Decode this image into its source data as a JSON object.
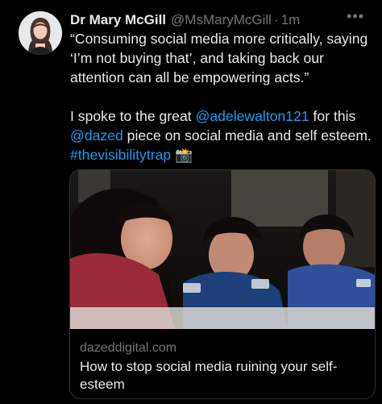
{
  "tweet": {
    "author_name": "Dr Mary McGill",
    "handle": "@MsMaryMcGill",
    "separator": "·",
    "time": "1m",
    "more_icon": "ellipsis-icon",
    "quote_text": "“Consuming social media more critically, saying ‘I’m not buying that’, and taking back our attention can all be empowering acts.”",
    "line2_prefix": "I spoke to the great ",
    "mention1": "@adelewalton121",
    "line2_mid": " for this ",
    "mention2": "@dazed",
    "line2_suffix": " piece on social media and self esteem. ",
    "hashtag": "#thevisibilitytrap",
    "emoji": "📸"
  },
  "card": {
    "domain": "dazeddigital.com",
    "title": "How to stop social media ruining your self-esteem"
  }
}
